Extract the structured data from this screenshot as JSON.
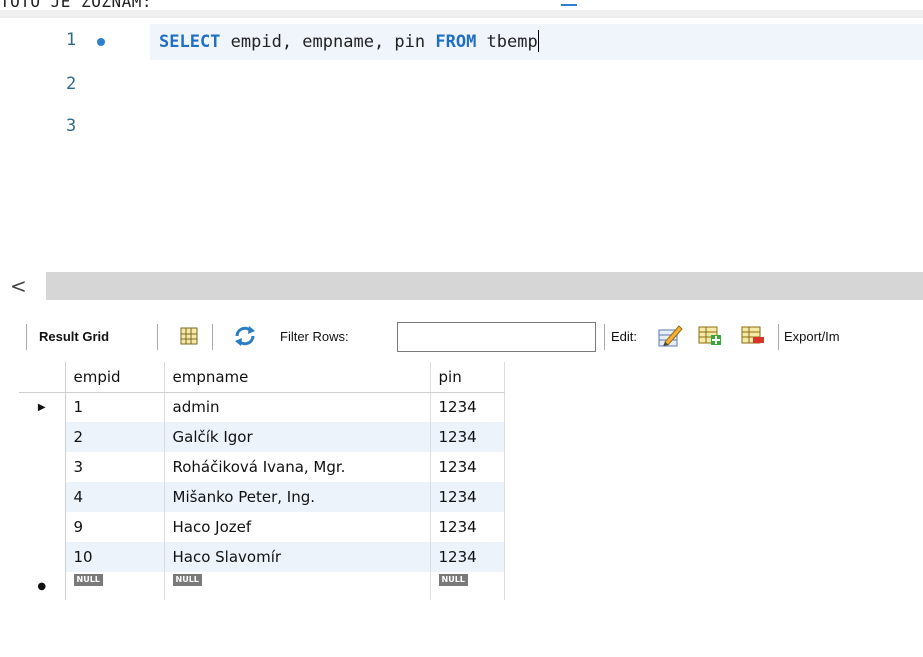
{
  "header": {
    "partial_text": "TOTO JE ZOZNAM:"
  },
  "editor": {
    "lines": [
      {
        "number": "1",
        "keyword1": "SELECT",
        "middle": " empid, empname, pin ",
        "keyword2": "FROM",
        "tail": " tbemp"
      },
      {
        "number": "2"
      },
      {
        "number": "3"
      }
    ]
  },
  "scrollbar": {
    "left_arrow": "<"
  },
  "toolbar": {
    "result_grid_label": "Result Grid",
    "filter_rows_label": "Filter Rows:",
    "filter_rows_value": "",
    "edit_label": "Edit:",
    "export_label": "Export/Im"
  },
  "grid": {
    "columns": [
      "empid",
      "empname",
      "pin"
    ],
    "rows": [
      {
        "empid": "1",
        "empname": "admin",
        "pin": "1234"
      },
      {
        "empid": "2",
        "empname": "Galčík Igor",
        "pin": "1234"
      },
      {
        "empid": "3",
        "empname": "Roháčiková Ivana, Mgr.",
        "pin": "1234"
      },
      {
        "empid": "4",
        "empname": "Mišanko Peter, Ing.",
        "pin": "1234"
      },
      {
        "empid": "9",
        "empname": "Haco Jozef",
        "pin": "1234"
      },
      {
        "empid": "10",
        "empname": "Haco Slavomír",
        "pin": "1234"
      }
    ],
    "null_label": "NULL",
    "current_row_marker": "▶",
    "new_row_marker": "●"
  },
  "colors": {
    "keyword": "#1f6fc4",
    "alt_row": "#edf3fb",
    "line_number": "#2d6a8a"
  }
}
